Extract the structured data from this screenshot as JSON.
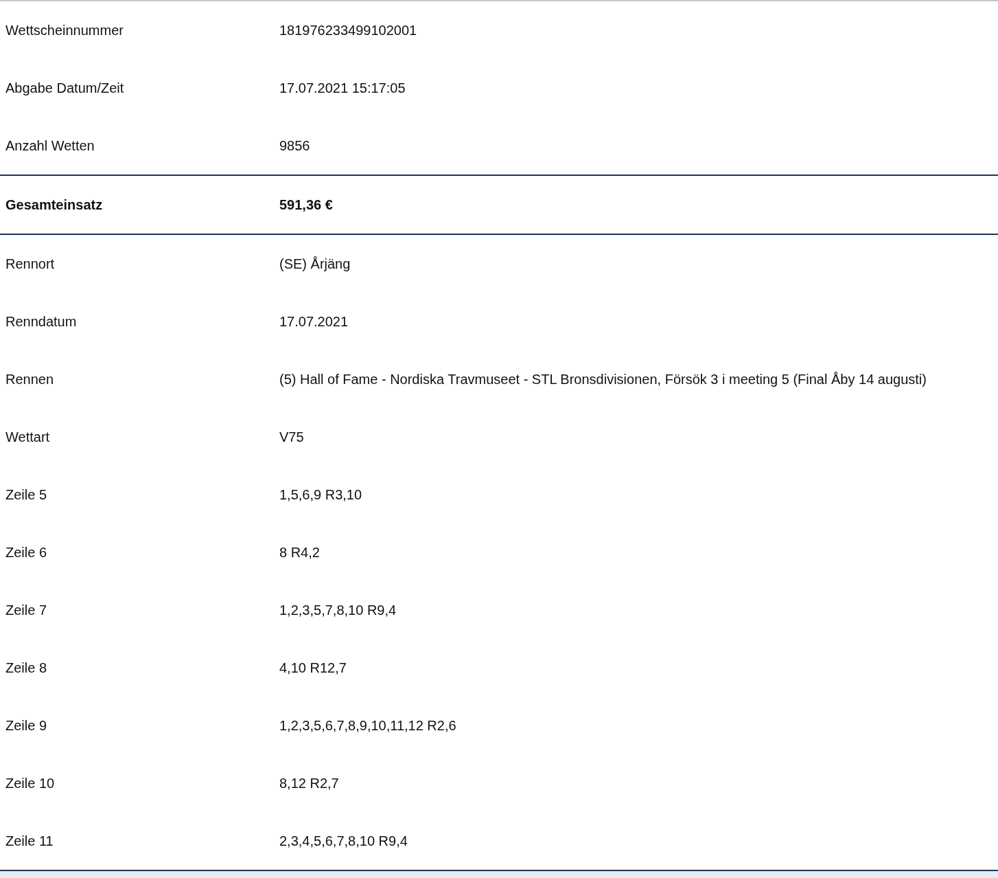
{
  "sections": [
    {
      "kind": "plain",
      "rows": [
        {
          "label": "Wettscheinnummer",
          "value": "181976233499102001"
        },
        {
          "label": "Abgabe Datum/Zeit",
          "value": "17.07.2021 15:17:05"
        },
        {
          "label": "Anzahl Wetten",
          "value": "9856"
        }
      ]
    },
    {
      "kind": "total",
      "rows": [
        {
          "label": "Gesamteinsatz",
          "value": "591,36 €"
        }
      ]
    },
    {
      "kind": "plain",
      "rows": [
        {
          "label": "Rennort",
          "value": "(SE) Årjäng"
        },
        {
          "label": "Renndatum",
          "value": "17.07.2021"
        },
        {
          "label": "Rennen",
          "value": "(5) Hall of Fame - Nordiska Travmuseet - STL Bronsdivisionen, Försök 3 i meeting 5 (Final Åby 14 augusti)"
        },
        {
          "label": "Wettart",
          "value": "V75"
        },
        {
          "label": "Zeile 5",
          "value": "1,5,6,9 R3,10"
        },
        {
          "label": "Zeile 6",
          "value": "8 R4,2"
        },
        {
          "label": "Zeile 7",
          "value": "1,2,3,5,7,8,10 R9,4"
        },
        {
          "label": "Zeile 8",
          "value": "4,10 R12,7"
        },
        {
          "label": "Zeile 9",
          "value": "1,2,3,5,6,7,8,9,10,11,12 R2,6"
        },
        {
          "label": "Zeile 10",
          "value": "8,12 R2,7"
        },
        {
          "label": "Zeile 11",
          "value": "2,3,4,5,6,7,8,10 R9,4"
        }
      ]
    }
  ]
}
